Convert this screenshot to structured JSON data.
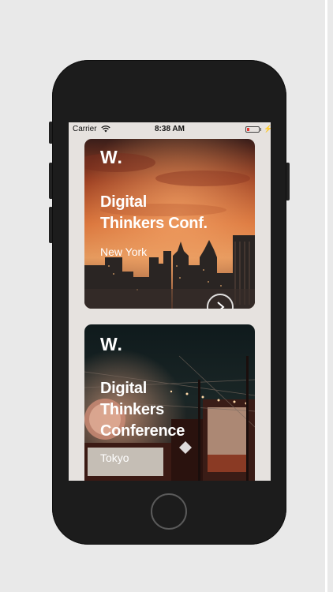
{
  "status_bar": {
    "carrier": "Carrier",
    "time": "8:38 AM",
    "icons": [
      "wifi-icon",
      "battery-icon",
      "charging-bolt-icon"
    ],
    "battery_color": "#e53935"
  },
  "cards": [
    {
      "logo": "W.",
      "title_line1": "Digital",
      "title_line2": "Thinkers Conf.",
      "city": "New York"
    },
    {
      "logo": "W.",
      "title_line1": "Digital",
      "title_line2": "Thinkers",
      "title_line3": "Conference",
      "city": "Tokyo"
    }
  ],
  "device": {
    "body_color": "#1c1c1c",
    "screen_bg": "#e6e2df"
  }
}
